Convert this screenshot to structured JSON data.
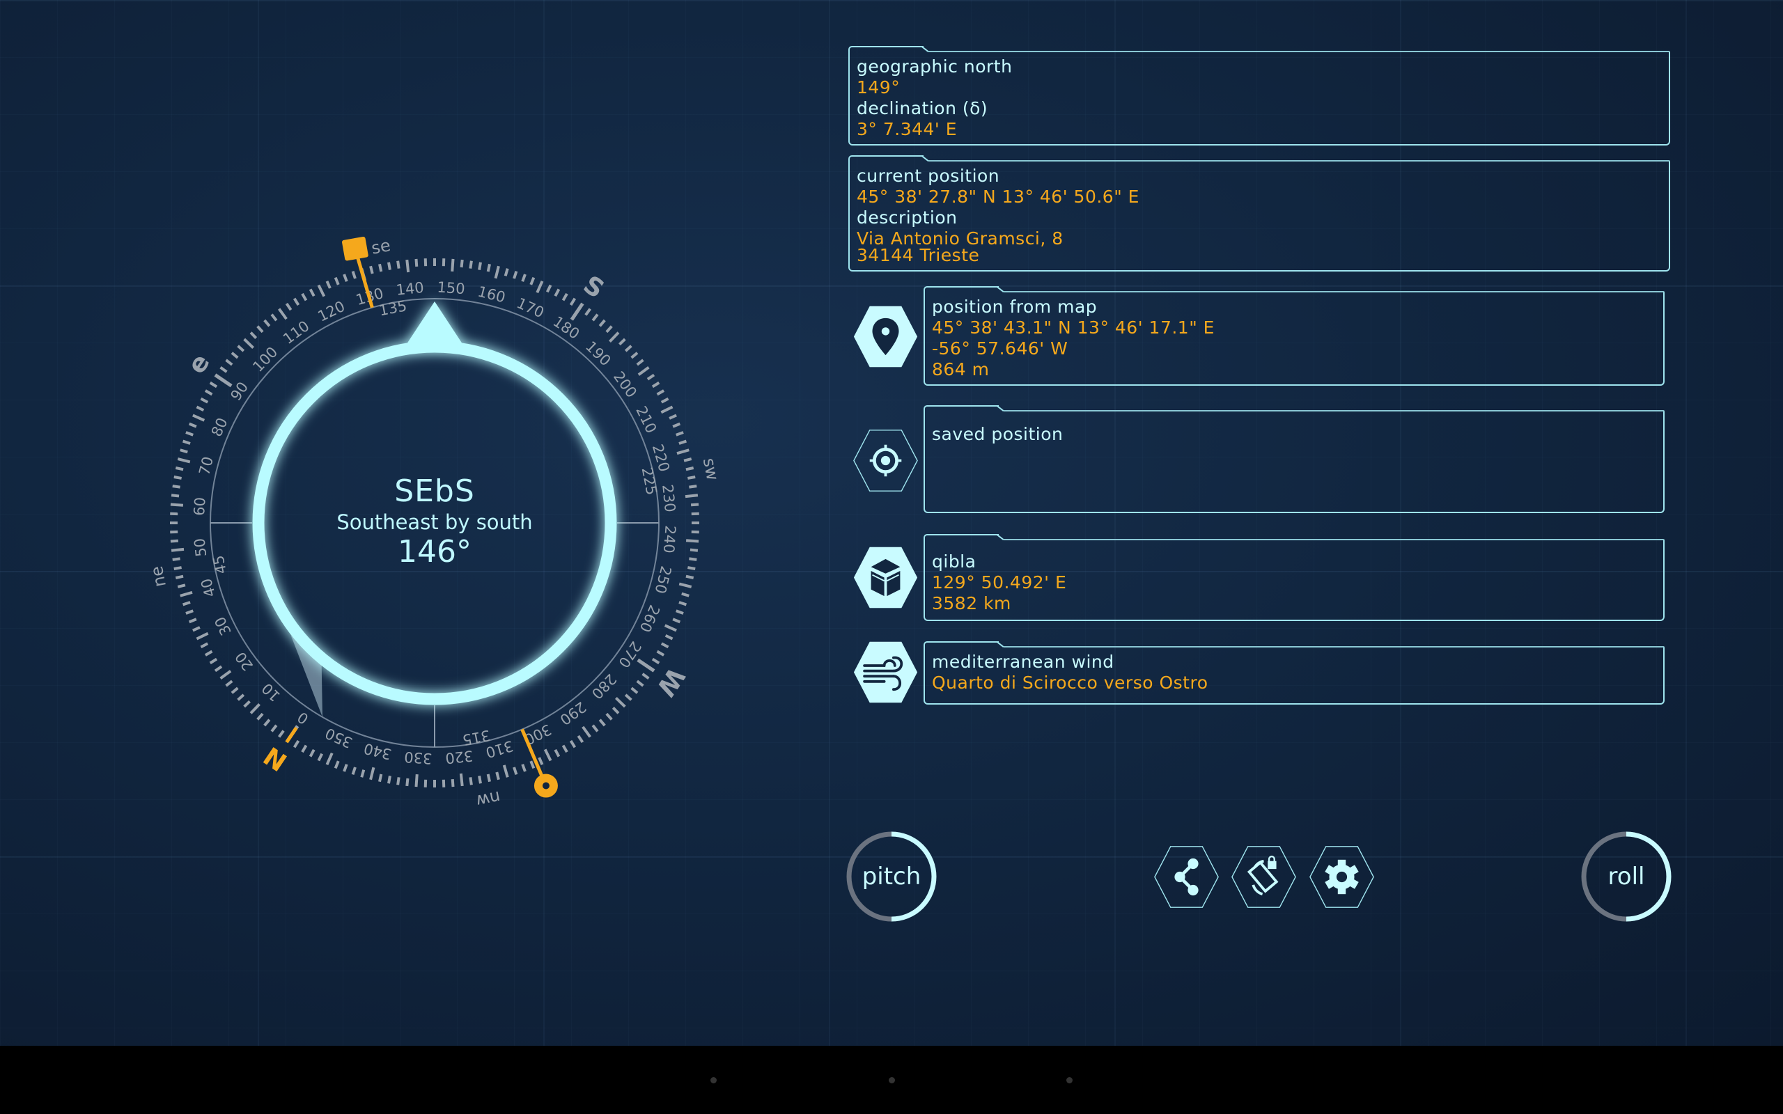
{
  "colors": {
    "accent": "#bff8ff",
    "value": "#f5a81c",
    "border": "#9fe4ee",
    "background": "#112640"
  },
  "compass": {
    "abbreviation": "SEbS",
    "direction_name": "Southeast by south",
    "heading": "146°",
    "heading_value": 146,
    "qibla_bearing": 129.84,
    "map_bearing": 303.04,
    "numbers": [
      "0",
      "10",
      "20",
      "30",
      "40",
      "50",
      "60",
      "70",
      "80",
      "90",
      "100",
      "110",
      "120",
      "130",
      "140",
      "150",
      "160",
      "170",
      "180",
      "190",
      "200",
      "210",
      "220",
      "230",
      "240",
      "250",
      "260",
      "270",
      "280",
      "290",
      "300",
      "310",
      "320",
      "330",
      "340",
      "350"
    ],
    "intercardinal_numbers": [
      "45",
      "135",
      "225",
      "315"
    ],
    "cardinals": {
      "n": "N",
      "e": "e",
      "s": "S",
      "w": "W",
      "ne": "ne",
      "se": "se",
      "sw": "sw",
      "nw": "nw"
    }
  },
  "panels": {
    "geographic": {
      "label": "geographic north",
      "value": "149°",
      "decl_label": "declination (δ)",
      "decl_value": "3° 7.344' E"
    },
    "current": {
      "label": "current position",
      "value": "45° 38' 27.8\" N 13° 46' 50.6\" E",
      "desc_label": "description",
      "desc_line1": "Via Antonio Gramsci, 8",
      "desc_line2": "34144 Trieste"
    },
    "map": {
      "icon": "map-pin-icon",
      "label": "position from map",
      "coords": "45° 38' 43.1\" N 13° 46' 17.1\" E",
      "bearing": "-56° 57.646' W",
      "distance": "864 m"
    },
    "saved": {
      "icon": "crosshair-icon",
      "label": "saved position"
    },
    "qibla": {
      "icon": "kaaba-icon",
      "label": "qibla",
      "bearing": "129° 50.492' E",
      "distance": "3582 km"
    },
    "wind": {
      "icon": "wind-icon",
      "label": "mediterranean wind",
      "value": "Quarto di Scirocco verso Ostro"
    }
  },
  "toolbar": {
    "pitch": "pitch",
    "roll": "roll",
    "share_icon": "share-icon",
    "lock_icon": "rotation-lock-icon",
    "settings_icon": "gear-icon"
  }
}
